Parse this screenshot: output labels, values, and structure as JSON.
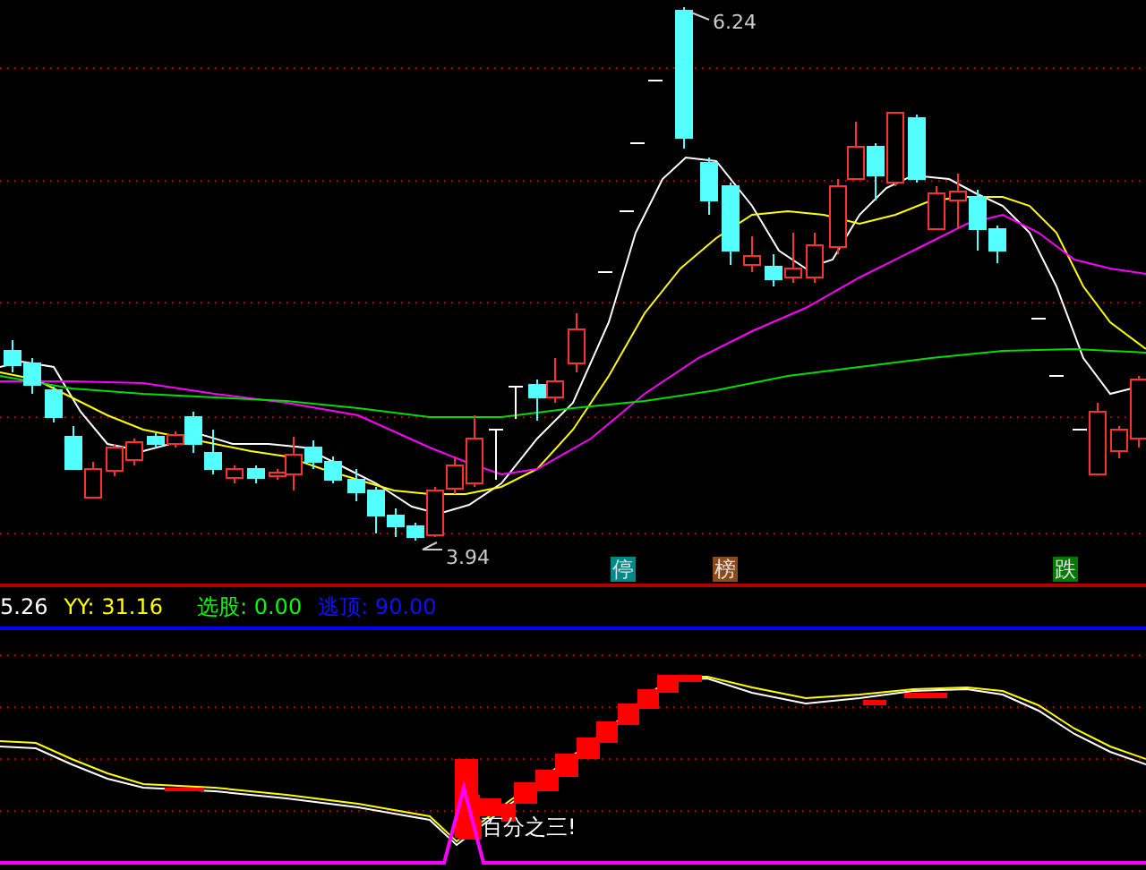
{
  "price_chart": {
    "high_label": "6.24",
    "low_label": "3.94",
    "markers": [
      {
        "text": "停",
        "color": "#008888"
      },
      {
        "text": "榜",
        "color": "#8b4a1a"
      },
      {
        "text": "跌",
        "color": "#007a00"
      }
    ]
  },
  "indicator_bar": {
    "readings": [
      {
        "text": "5.26",
        "color": "#ffffff"
      },
      {
        "text": "YY: 31.16",
        "color": "#ffff00"
      },
      {
        "text": "选股: 0.00",
        "color": "#00ff00"
      },
      {
        "text": "逃顶: 90.00",
        "color": "#1010ff"
      }
    ]
  },
  "indicator_chart": {
    "callout": "百分之三!"
  }
}
